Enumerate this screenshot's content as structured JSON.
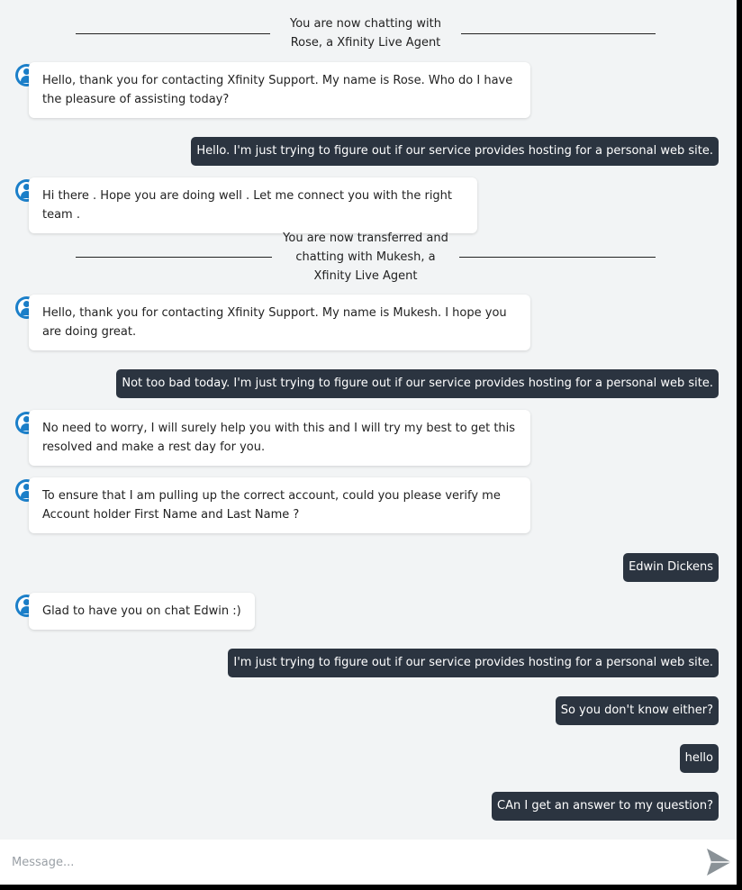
{
  "dividers": [
    "You are now chatting with Rose, a Xfinity Live Agent",
    "You are now transferred and chatting with Mukesh, a Xfinity Live Agent"
  ],
  "messages": [
    {
      "from": "agent",
      "text": "Hello, thank you for contacting Xfinity Support. My name is Rose. Who do I have the pleasure of assisting today?"
    },
    {
      "from": "user",
      "text": "Hello. I'm just trying to figure out if our service provides hosting for a personal web site."
    },
    {
      "from": "agent",
      "text": "Hi there . Hope you are doing well . Let me connect you with the right team ."
    },
    {
      "from": "agent",
      "text": "Hello, thank you for contacting Xfinity Support. My name is Mukesh. I hope you are doing great."
    },
    {
      "from": "user",
      "text": "Not too bad today. I'm just trying to figure out if our service provides hosting for a personal web site."
    },
    {
      "from": "agent",
      "text": "No need to worry, I will surely help you with this and I will try my best to get this resolved and make a rest day for you."
    },
    {
      "from": "agent",
      "text": "To ensure that I am pulling up the correct account, could you please verify me Account holder First Name and Last Name ?"
    },
    {
      "from": "user",
      "text": "Edwin Dickens"
    },
    {
      "from": "agent",
      "text": "Glad to have you on chat Edwin :)"
    },
    {
      "from": "user",
      "text": "I'm just trying to figure out if our service provides hosting for a personal web site."
    },
    {
      "from": "user",
      "text": "So you don't know either?"
    },
    {
      "from": "user",
      "text": "hello"
    },
    {
      "from": "user",
      "text": "CAn I get an answer to my question?"
    }
  ],
  "composer": {
    "placeholder": "Message..."
  },
  "icons": {
    "agent_avatar": "agent-avatar-icon",
    "send": "send-icon"
  },
  "colors": {
    "user_bubble": "#2b3440",
    "avatar": "#1b7fc9",
    "background": "#f2f4f5"
  }
}
